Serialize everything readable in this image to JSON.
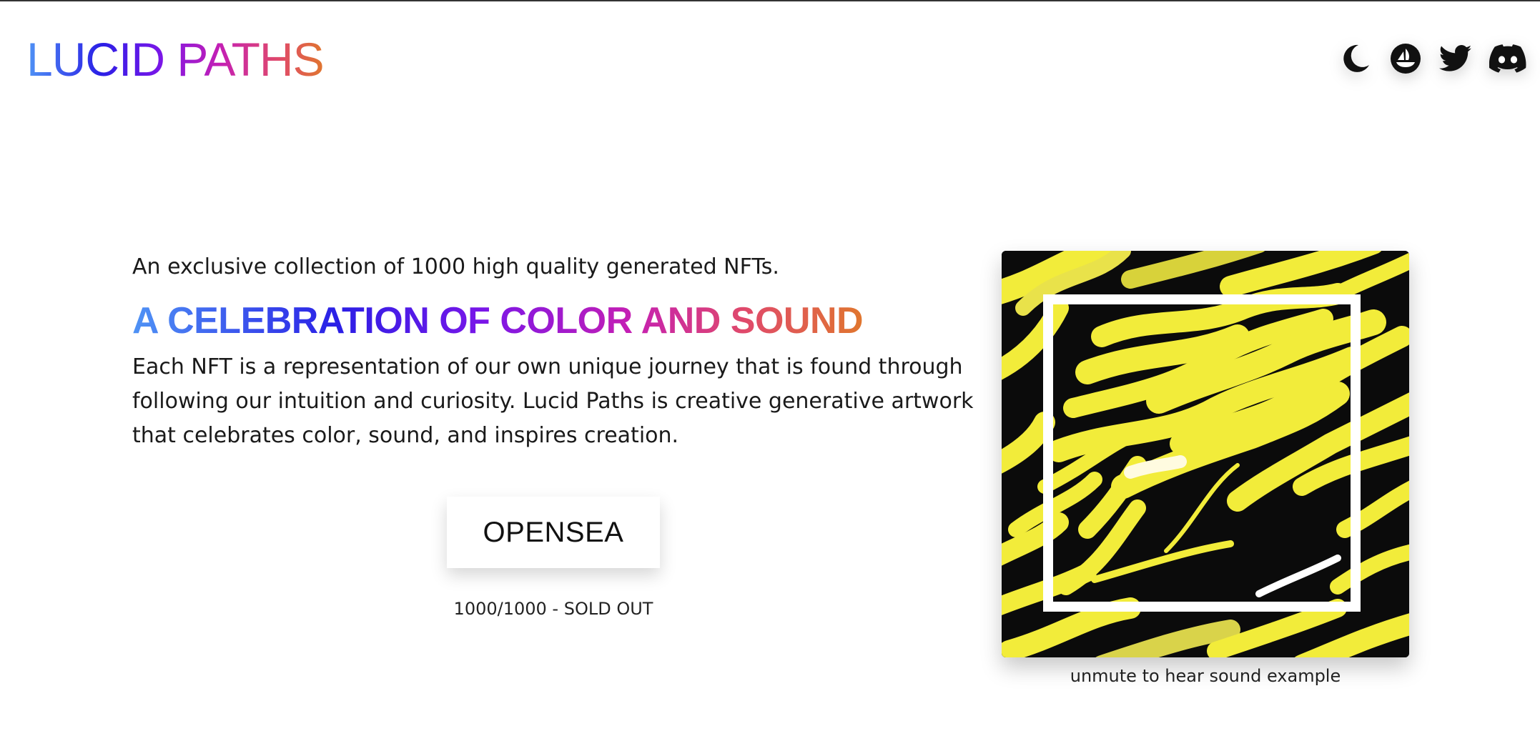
{
  "header": {
    "logo": "LUCID PATHS",
    "nav": [
      {
        "name": "dark-mode-toggle",
        "icon": "moon-icon"
      },
      {
        "name": "opensea-link",
        "icon": "opensea-icon"
      },
      {
        "name": "twitter-link",
        "icon": "twitter-icon"
      },
      {
        "name": "discord-link",
        "icon": "discord-icon"
      }
    ]
  },
  "hero": {
    "tagline": "An exclusive collection of 1000 high quality generated NFTs.",
    "headline": "A CELEBRATION OF COLOR AND SOUND",
    "description": "Each NFT is a representation of our own unique journey that is found through following our intuition and curiosity. Lucid Paths is creative generative artwork that celebrates color, sound, and inspires creation.",
    "cta_label": "OPENSEA",
    "supply": "1000/1000 - SOLD OUT"
  },
  "media": {
    "caption": "unmute to hear sound example",
    "colors": {
      "primary": "#f2ec3a",
      "background": "#0b0b0b",
      "frame": "#ffffff"
    }
  }
}
